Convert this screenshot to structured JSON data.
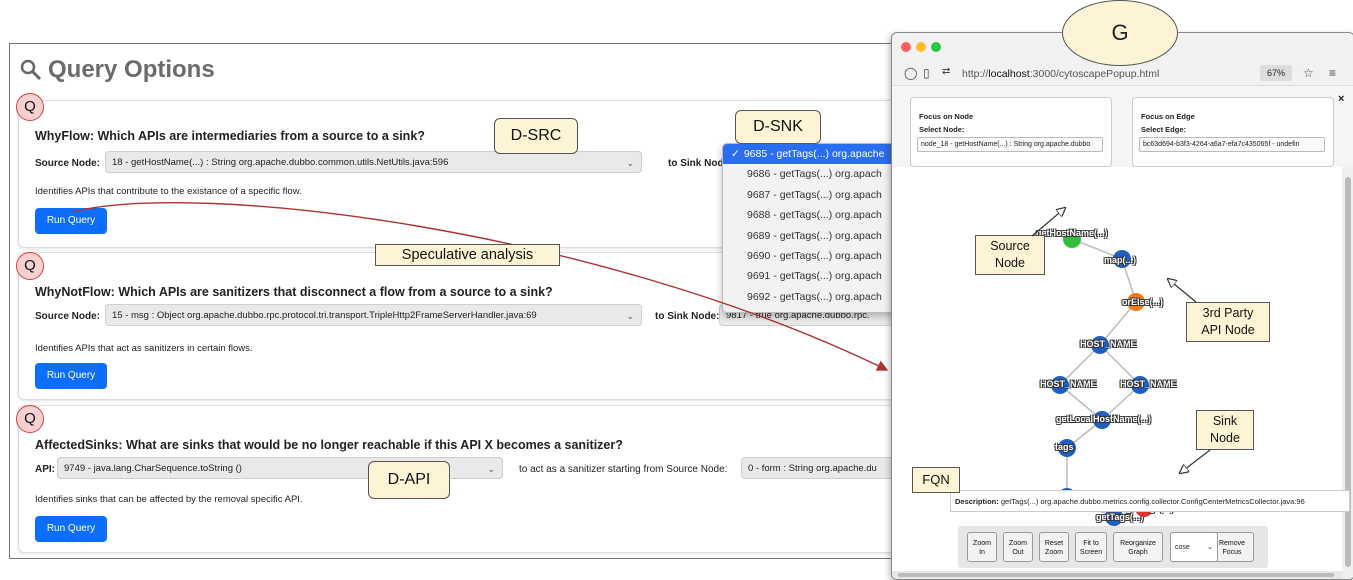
{
  "main": {
    "title": "Query Options",
    "queries": [
      {
        "title": "WhyFlow: Which APIs are intermediaries from a source to a sink?",
        "field1_label": "Source Node:",
        "field1_value": "18 - getHostName(...) : String org.apache.dubbo.common.utils.NetUtils.java:596",
        "field2_label": "to Sink Node:",
        "description": "Identifies APIs that contribute to the existance of a specific flow.",
        "button": "Run Query"
      },
      {
        "title": "WhyNotFlow: Which APIs are sanitizers that disconnect a flow from a source to a sink?",
        "field1_label": "Source Node:",
        "field1_value": "15 - msg : Object org.apache.dubbo.rpc.protocol.tri.transport.TripleHttp2FrameServerHandler.java:69",
        "field2_label": "to Sink Node:",
        "field2_value": "9817 - true org.apache.dubbo.rpc.",
        "description": "Identifies APIs that act as sanitizers in certain flows.",
        "button": "Run Query"
      },
      {
        "title": "AffectedSinks: What are sinks that would be no longer reachable if this API X becomes a sanitizer?",
        "field1_label": "API:",
        "field1_value": "9749 - java.lang.CharSequence.toString ()",
        "field2_label": "to act as a sanitizer starting from Source Node:",
        "field2_value": "0 - form : String org.apache.du",
        "description": "Identifies sinks that can be affected by the removal specific API.",
        "button": "Run Query"
      }
    ]
  },
  "sink_dropdown": {
    "options": [
      "9685 - getTags(...) org.apache",
      "9686 - getTags(...) org.apach",
      "9687 - getTags(...) org.apach",
      "9688 - getTags(...) org.apach",
      "9689 - getTags(...) org.apach",
      "9690 - getTags(...) org.apach",
      "9691 - getTags(...) org.apach",
      "9692 - getTags(...) org.apach"
    ],
    "selected_index": 0,
    "check": "✓"
  },
  "annotations": {
    "q": "Q",
    "g": "G",
    "d_src": "D-SRC",
    "d_snk": "D-SNK",
    "d_api": "D-API",
    "speculative": "Speculative analysis",
    "source_node": "Source\nNode",
    "third_party": "3rd Party\nAPI Node",
    "sink_node": "Sink\nNode",
    "fqn": "FQN"
  },
  "browser": {
    "url_prefix": "http://",
    "url_host": "localhost",
    "url_rest": ":3000/cytoscapePopup.html",
    "zoom": "67%",
    "close": "×",
    "focus_node": {
      "title": "Focus on Node",
      "label": "Select Node:",
      "value": "node_18 - getHostName(...) : String org.apache.dubbo"
    },
    "focus_edge": {
      "title": "Focus on Edge",
      "label": "Select Edge:",
      "value": "bc63d694-b3f3-4264-a6a7-efa7c435065f - undefin"
    },
    "graph_nodes": [
      {
        "label": "getHostName(...)",
        "color": "#2fbf3a"
      },
      {
        "label": "map(...)",
        "color": "#1f5fbf"
      },
      {
        "label": "orElse(...)",
        "color": "#f07a1a"
      },
      {
        "label": "HOST_NAME",
        "color": "#1f5fbf"
      },
      {
        "label": "HOST_NAME",
        "color": "#1f5fbf"
      },
      {
        "label": "HOST_NAME",
        "color": "#1f5fbf"
      },
      {
        "label": "getLocalHostName(...)",
        "color": "#1f5fbf"
      },
      {
        "label": "tags",
        "color": "#1f5fbf"
      },
      {
        "label": "tags",
        "color": "#1f5fbf"
      },
      {
        "label": "getTags(...)",
        "color": "#1f5fbf"
      },
      {
        "label": "getTags(...)",
        "color": "#e03030"
      }
    ],
    "description_label": "Description:",
    "description_value": "getTags(...) org.apache.dubbo.metrics.config.collector.ConfigCenterMetricsCollector.java:96",
    "buttons": [
      "Zoom\nIn",
      "Zoom\nOut",
      "Reset\nZoom",
      "Fit to\nScreen",
      "Reorganize\nGraph",
      "Remove\nFocus"
    ],
    "layout_select": "cose"
  }
}
